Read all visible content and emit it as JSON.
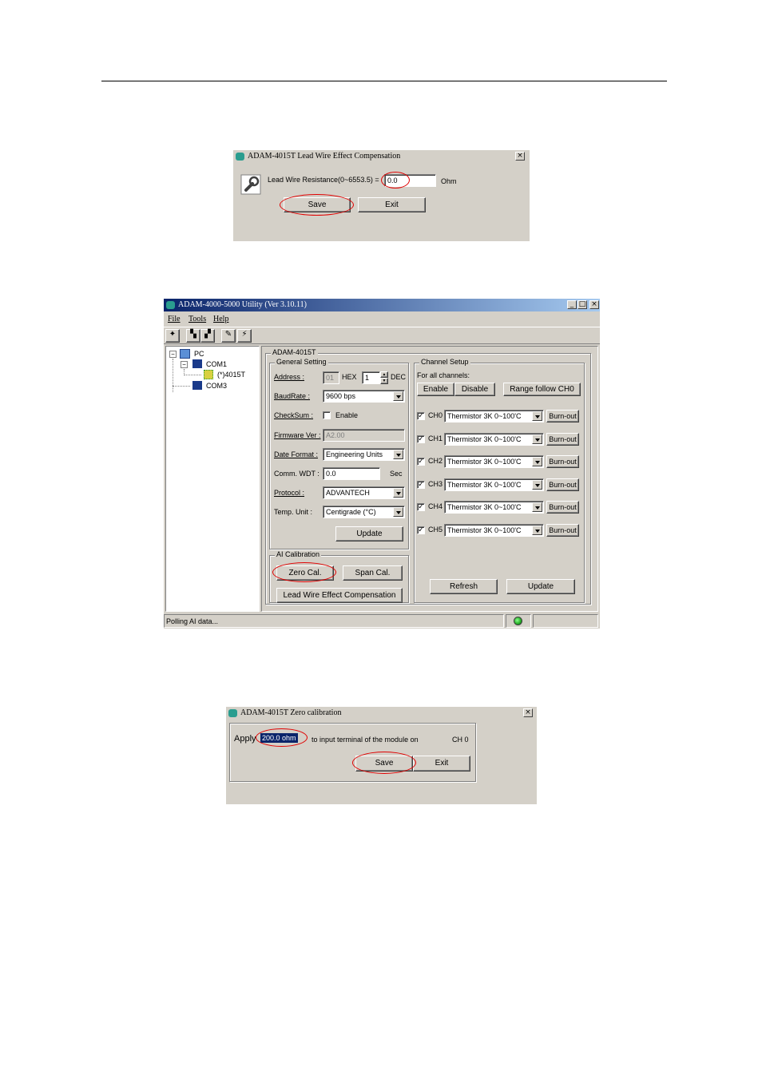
{
  "dialog1": {
    "title": "ADAM-4015T Lead Wire Effect Compensation",
    "label": "Lead Wire Resistance(0~6553.5) =",
    "value": "0.0",
    "unit": "Ohm",
    "save": "Save",
    "exit": "Exit",
    "close": "×"
  },
  "utility": {
    "title": "ADAM-4000-5000 Utility (Ver 3.10.11)",
    "menu": [
      "File",
      "Tools",
      "Help"
    ],
    "tree": {
      "root": "PC",
      "com1": "COM1",
      "device": "(*)4015T",
      "com3": "COM3"
    },
    "panel_title": "ADAM-4015T",
    "general": {
      "title": "General Setting",
      "address_label": "Address :",
      "address_hex": "01",
      "hex": "HEX",
      "address_dec": "1",
      "dec": "DEC",
      "baud_label": "BaudRate :",
      "baud_value": "9600 bps",
      "checksum_label": "CheckSum :",
      "checksum_enable": "Enable",
      "firmware_label": "Firmware Ver :",
      "firmware_value": "A2.00",
      "date_label": "Date Format :",
      "date_value": "Engineering Units",
      "wdt_label": "Comm. WDT :",
      "wdt_value": "0.0",
      "wdt_unit": "Sec",
      "protocol_label": "Protocol :",
      "protocol_value": "ADVANTECH",
      "temp_label": "Temp. Unit :",
      "temp_value": "Centigrade (°C)",
      "update": "Update"
    },
    "calibration": {
      "title": "AI Calibration",
      "zero": "Zero Cal.",
      "span": "Span Cal.",
      "leadwire": "Lead Wire Effect Compensation"
    },
    "channel": {
      "title": "Channel Setup",
      "for_all": "For all channels:",
      "enable": "Enable",
      "disable": "Disable",
      "range_follow": "Range follow CH0",
      "rows": [
        {
          "ch": "CH0",
          "range": "Thermistor 3K 0~100'C",
          "burn": "Burn-out"
        },
        {
          "ch": "CH1",
          "range": "Thermistor 3K 0~100'C",
          "burn": "Burn-out"
        },
        {
          "ch": "CH2",
          "range": "Thermistor 3K 0~100'C",
          "burn": "Burn-out"
        },
        {
          "ch": "CH3",
          "range": "Thermistor 3K 0~100'C",
          "burn": "Burn-out"
        },
        {
          "ch": "CH4",
          "range": "Thermistor 3K 0~100'C",
          "burn": "Burn-out"
        },
        {
          "ch": "CH5",
          "range": "Thermistor 3K 0~100'C",
          "burn": "Burn-out"
        }
      ],
      "refresh": "Refresh",
      "update": "Update"
    },
    "status": "Polling AI data..."
  },
  "dialog2": {
    "title": "ADAM-4015T Zero calibration",
    "apply": "Apply",
    "value": "200.0 ohm",
    "text": "to input terminal of the module on",
    "channel": "CH 0",
    "save": "Save",
    "exit": "Exit",
    "close": "×"
  },
  "colors": {
    "title_start": "#0a246a",
    "title_end": "#a6caf0",
    "face": "#d4d0c8",
    "highlight_ellipse": "#e00000",
    "status_led": "#22aa22"
  }
}
